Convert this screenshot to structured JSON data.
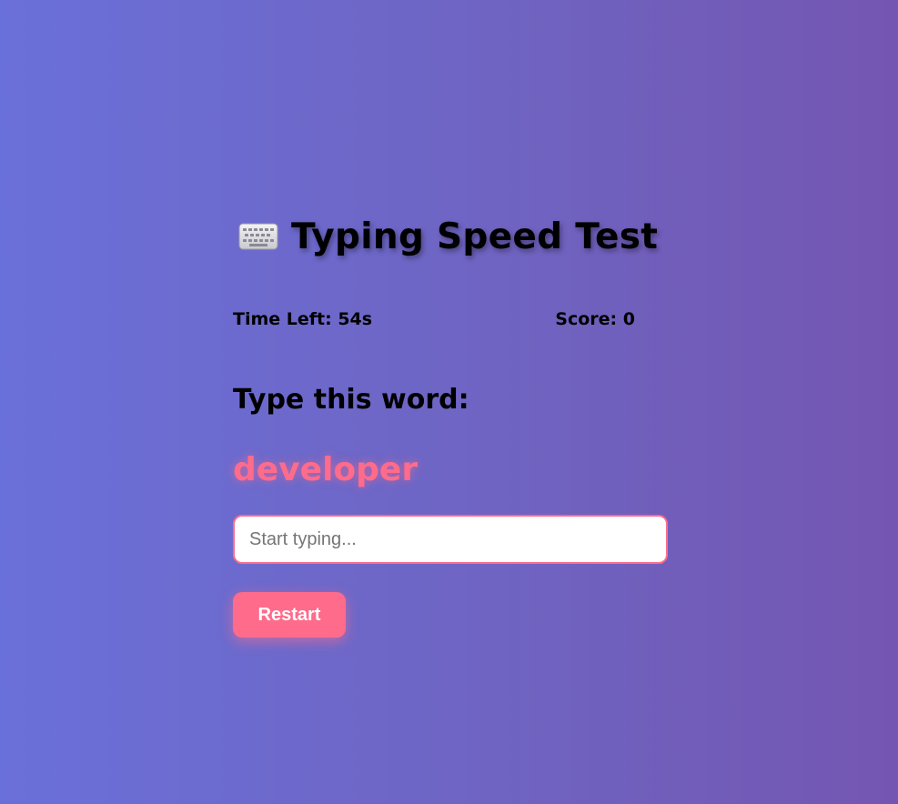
{
  "header": {
    "icon": "keyboard-icon",
    "title": "Typing Speed Test"
  },
  "stats": {
    "time_left": "Time Left: 54s",
    "score": "Score: 0"
  },
  "prompt": {
    "label": "Type this word:",
    "word": "developer"
  },
  "input": {
    "value": "",
    "placeholder": "Start typing..."
  },
  "controls": {
    "restart_label": "Restart"
  },
  "colors": {
    "accent": "#ff6b8b",
    "background_start": "#6a70d9",
    "background_end": "#7456b2"
  }
}
